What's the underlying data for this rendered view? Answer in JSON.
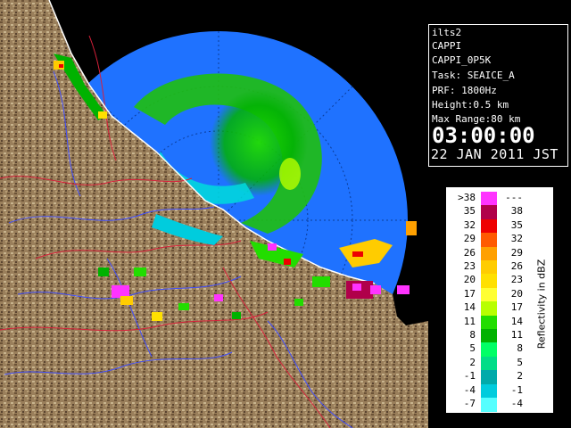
{
  "info": {
    "radar_name": "ilts2",
    "product": "CAPPI",
    "product_id": "CAPPI_0P5K",
    "task": "Task: SEAICE_A",
    "prf": "PRF: 1800Hz",
    "height": "Height:0.5 km",
    "max_range": "Max Range:80 km",
    "time": "03:00:00",
    "date": "22 JAN 2011 JST"
  },
  "legend": {
    "unit_label": "Reflectivity in dBZ",
    "rows": [
      {
        "low": ">38",
        "high": "---",
        "color": "#ff33ff"
      },
      {
        "low": "35",
        "high": "38",
        "color": "#b0004a"
      },
      {
        "low": "32",
        "high": "35",
        "color": "#ee0000"
      },
      {
        "low": "29",
        "high": "32",
        "color": "#ff5a00"
      },
      {
        "low": "26",
        "high": "29",
        "color": "#ffa000"
      },
      {
        "low": "23",
        "high": "26",
        "color": "#ffcc00"
      },
      {
        "low": "20",
        "high": "23",
        "color": "#ffe000"
      },
      {
        "low": "17",
        "high": "20",
        "color": "#ffff33"
      },
      {
        "low": "14",
        "high": "17",
        "color": "#b8ff00"
      },
      {
        "low": "11",
        "high": "14",
        "color": "#22dd00"
      },
      {
        "low": "8",
        "high": "11",
        "color": "#00b200"
      },
      {
        "low": "5",
        "high": "8",
        "color": "#00ff66"
      },
      {
        "low": "2",
        "high": "5",
        "color": "#00dd88"
      },
      {
        "low": "-1",
        "high": "2",
        "color": "#00aaaa"
      },
      {
        "low": "-4",
        "high": "-1",
        "color": "#00ccdd"
      },
      {
        "low": "-7",
        "high": "-4",
        "color": "#55ffff"
      }
    ]
  },
  "colors": {
    "range_disk": "#1f72ff",
    "land": "#9a7f5b",
    "water": "#000000"
  }
}
